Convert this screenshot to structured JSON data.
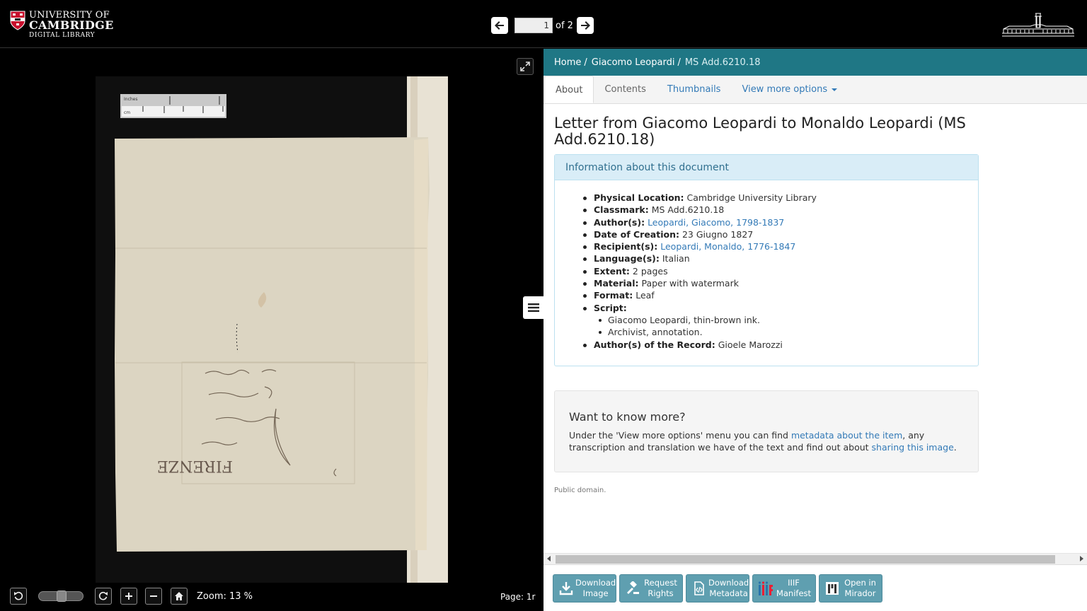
{
  "header": {
    "logo_line1": "UNIVERSITY OF",
    "logo_line2": "CAMBRIDGE",
    "logo_line3": "DIGITAL LIBRARY",
    "page_input_value": "1",
    "page_of": "of 2"
  },
  "viewer": {
    "zoom_label": "Zoom: 13 %",
    "page_label": "Page: 1r",
    "ruler_top_label": "Inches",
    "ruler_bottom_label": "cm",
    "zoom_slider_level": 0.5
  },
  "breadcrumb": {
    "home": "Home",
    "sep1": "/",
    "collection": "Giacomo Leopardi",
    "sep2": "/",
    "current": "MS Add.6210.18"
  },
  "tabs": {
    "about": "About",
    "contents": "Contents",
    "thumbnails": "Thumbnails",
    "view_more": "View more options"
  },
  "document": {
    "title": "Letter from Giacomo Leopardi to Monaldo Leopardi (MS Add.6210.18)",
    "info_heading": "Information about this document",
    "physical_location_label": "Physical Location:",
    "physical_location": "Cambridge University Library",
    "classmark_label": "Classmark:",
    "classmark": "MS Add.6210.18",
    "authors_label": "Author(s):",
    "authors": "Leopardi, Giacomo, 1798-1837",
    "date_label": "Date of Creation:",
    "date": "23 Giugno 1827",
    "recipients_label": "Recipient(s):",
    "recipients": "Leopardi, Monaldo, 1776-1847",
    "language_label": "Language(s):",
    "language": "Italian",
    "extent_label": "Extent:",
    "extent": "2 pages",
    "material_label": "Material:",
    "material": "Paper with watermark",
    "format_label": "Format:",
    "format": "Leaf",
    "script_label": "Script:",
    "script_items": [
      "Giacomo Leopardi, thin-brown ink.",
      "Archivist, annotation."
    ],
    "record_authors_label": "Author(s) of the Record:",
    "record_authors": "Gioele Marozzi"
  },
  "more": {
    "title": "Want to know more?",
    "text1": "Under the 'View more options' menu you can find ",
    "link1": "metadata about the item",
    "text2": ", any transcription and translation we have of the text and find out about ",
    "link2": "sharing this image",
    "text3": "."
  },
  "license": "Public domain.",
  "actions": {
    "download_image_1": "Download",
    "download_image_2": "Image",
    "request_rights_1": "Request",
    "request_rights_2": "Rights",
    "download_metadata_1": "Download",
    "download_metadata_2": "Metadata",
    "iiif_1": "IIIF",
    "iiif_2": "Manifest",
    "mirador_1": "Open in",
    "mirador_2": "Mirador"
  },
  "colors": {
    "breadcrumb_bg": "#1f7785",
    "action_button_bg": "#5f9fb0",
    "info_heading_bg": "#d9edf7",
    "link": "#337ab7"
  }
}
